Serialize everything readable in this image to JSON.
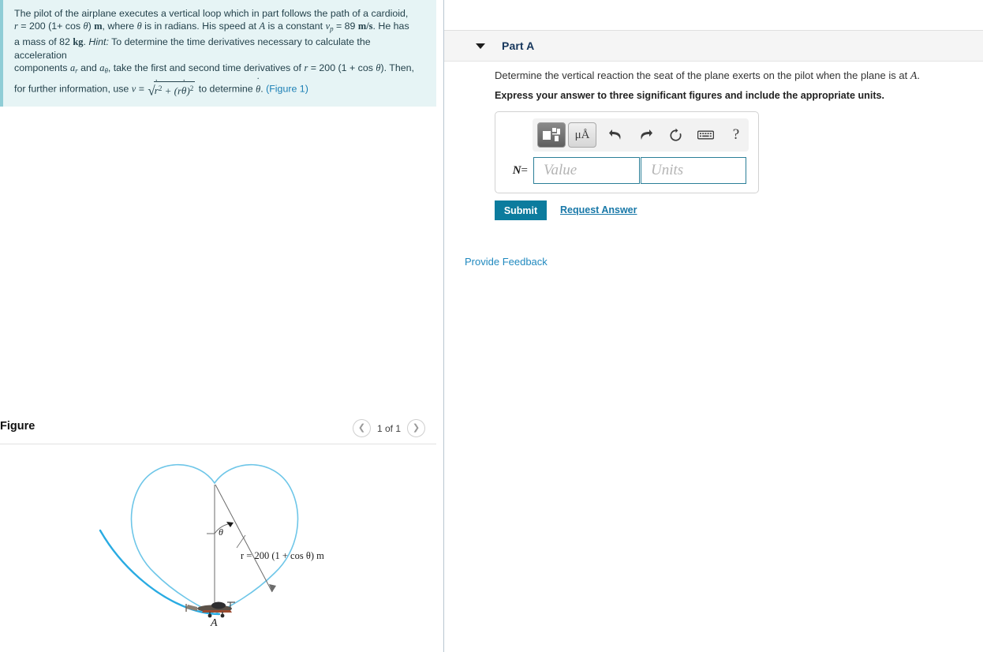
{
  "problem": {
    "line1": "The pilot of the airplane executes a vertical loop which in part follows the path of a cardioid,",
    "r_expr_prefix": "= 200 (1+ cos",
    "r_symbol": "r",
    "theta": "θ",
    "unit_m": "m",
    "line2_tail": ", where",
    "theta_phrase": "is in radians. His speed at",
    "point_A": "A",
    "is_constant": "is a constant",
    "vp_symbol": "v",
    "vp_sub": "p",
    "vp_value": "= 89",
    "vp_unit": "m/s",
    "he_has": ". He has",
    "mass_phrase": "a mass of 82",
    "mass_unit": "kg",
    "hint_label": "Hint:",
    "hint_text": "To determine the time derivatives necessary to calculate the acceleration",
    "components_text": "components",
    "a_r": "a",
    "a_r_sub": "r",
    "and_text": "and",
    "a_theta": "a",
    "a_theta_sub": "θ",
    "take_text": ", take the first and second time derivatives of",
    "r_expr2": "= 200 (1 + cos",
    "then_text": "). Then,",
    "for_further": "for further information, use",
    "v_symbol": "v",
    "equals": "=",
    "radicand": "ṙ² + (rθ̇)²",
    "determine_text": "to determine",
    "theta_dot": "θ",
    "figure_ref": "(Figure 1)"
  },
  "figure": {
    "title": "Figure",
    "nav_prev_icon": "chevron-left-icon",
    "nav_next_icon": "chevron-right-icon",
    "counter": "1 of 1",
    "label_r": "r = 200 (1 + cos θ) m",
    "label_theta": "θ",
    "label_point": "A",
    "cardioid_color": "#6ec6e8",
    "path_color": "#29abe2",
    "line_color": "#6b6b6b"
  },
  "part": {
    "caret_icon": "caret-down-icon",
    "label": "Part A",
    "question": "Determine the vertical reaction the seat of the plane exerts on the pilot when the plane is at",
    "question_point": "A",
    "question_period": ".",
    "instruction": "Express your answer to three significant figures and include the appropriate units."
  },
  "answer": {
    "toolbar": [
      {
        "name": "math-template-icon",
        "label": "template"
      },
      {
        "name": "units-icon",
        "label": "μÅ"
      },
      {
        "name": "undo-icon",
        "label": "↶"
      },
      {
        "name": "redo-icon",
        "label": "↷"
      },
      {
        "name": "reset-icon",
        "label": "↺"
      },
      {
        "name": "keyboard-icon",
        "label": "⌨"
      },
      {
        "name": "help-icon",
        "label": "?"
      }
    ],
    "variable": "N",
    "equals": "=",
    "value_placeholder": "Value",
    "units_placeholder": "Units"
  },
  "actions": {
    "submit_label": "Submit",
    "request_answer_label": "Request Answer",
    "provide_feedback_label": "Provide Feedback",
    "submit_color": "#0c7c9e",
    "link_color": "#1878a8"
  }
}
